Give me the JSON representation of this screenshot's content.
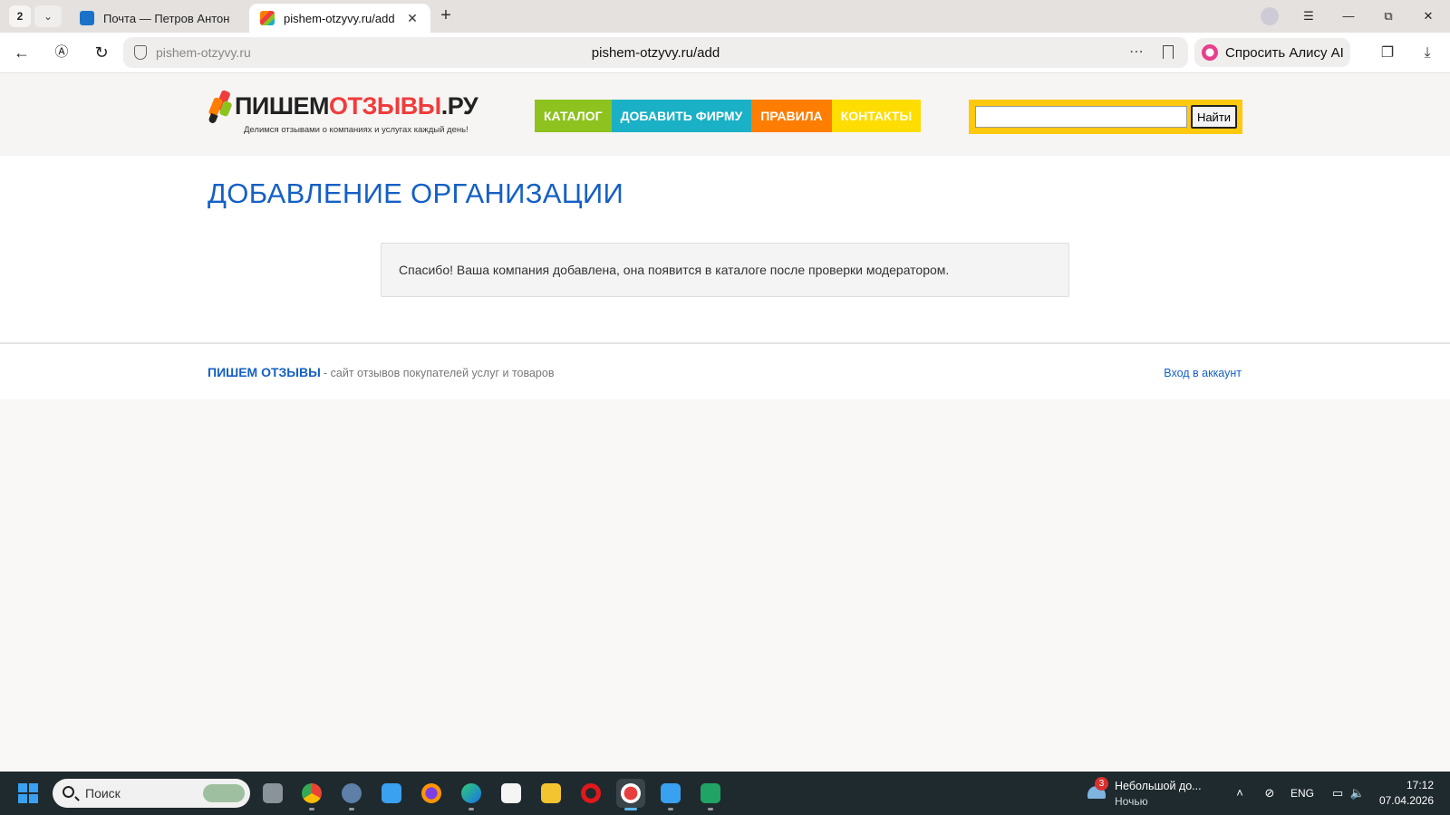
{
  "browser": {
    "tab_count": "2",
    "tabs": [
      {
        "title": "Почта — Петров Антон —",
        "favicon": "mail-icon",
        "active": false
      },
      {
        "title": "pishem-otzyvy.ru/add",
        "favicon": "site-favicon",
        "active": true
      }
    ],
    "address": {
      "host": "pishem-otzyvy.ru",
      "url": "pishem-otzyvy.ru/add"
    },
    "alice_label": "Спросить Алису AI"
  },
  "site": {
    "logo": {
      "part1": "ПИШЕМ",
      "part2": "ОТЗЫВЫ",
      "part3": ".РУ",
      "tagline": "Делимся отзывами о компаниях и услугах каждый день!"
    },
    "menu": [
      {
        "label": "КАТАЛОГ",
        "color": "#8dc21f"
      },
      {
        "label": "ДОБАВИТЬ ФИРМУ",
        "color": "#1ab0c6"
      },
      {
        "label": "ПРАВИЛА",
        "color": "#ff7d00"
      },
      {
        "label": "КОНТАКТЫ",
        "color": "#ffdd00"
      }
    ],
    "search": {
      "value": "",
      "button_label": "Найти"
    },
    "page_title": "ДОБАВЛЕНИЕ ОРГАНИЗАЦИИ",
    "notice": "Спасибо! Ваша компания добавлена, она появится в каталоге после проверки модератором.",
    "footer": {
      "brand": "ПИШЕМ ОТЗЫВЫ",
      "description": "- сайт отзывов покупателей услуг и товаров",
      "login": "Вход в аккаунт"
    },
    "colors": {
      "accent_blue": "#1560c4",
      "search_frame": "#ffc90e"
    }
  },
  "taskbar": {
    "search_placeholder": "Поиск",
    "apps": [
      "task-view-icon",
      "chrome-icon",
      "settings-icon",
      "app-icon",
      "firefox-icon",
      "edge-icon",
      "store-icon",
      "file-explorer-icon",
      "opera-icon",
      "yandex-browser-icon",
      "notepad-icon",
      "spreadsheet-icon"
    ],
    "weather": {
      "badge": "3",
      "line1": "Небольшой до...",
      "line2": "Ночью"
    },
    "language": "ENG",
    "time": "17:12",
    "date": "07.04.2026"
  }
}
